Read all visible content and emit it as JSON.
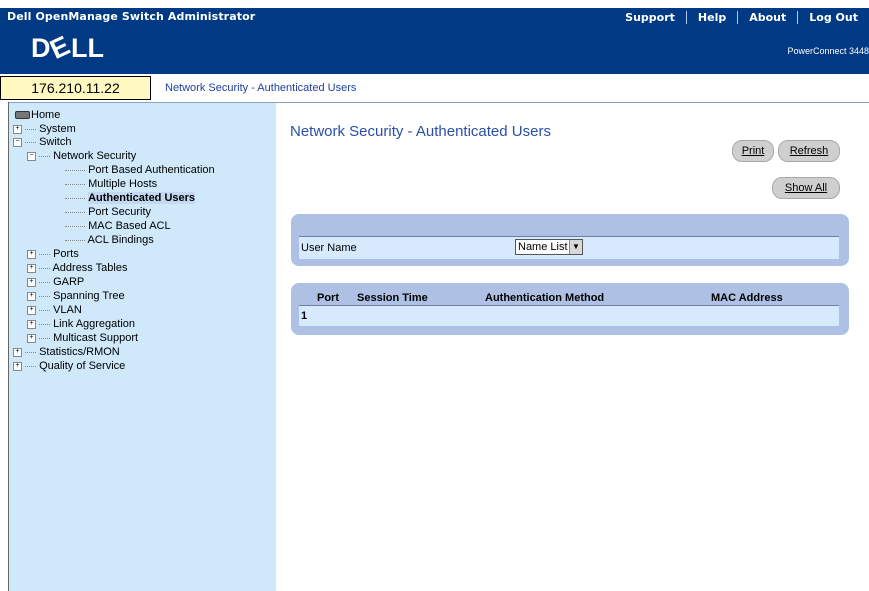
{
  "window": {
    "app_title": "Dell OpenManage Switch Administrator",
    "top_links": [
      "Support",
      "Help",
      "About",
      "Log Out"
    ],
    "logo": "DELL",
    "product": "PowerConnect 3448"
  },
  "address": {
    "ip": "176.210.11.22",
    "breadcrumb": "Network Security - Authenticated Users"
  },
  "sidebar": {
    "items": [
      {
        "label": "Home"
      },
      {
        "label": "System"
      },
      {
        "label": "Switch"
      },
      {
        "label": "Network Security"
      },
      {
        "label": "Port Based Authentication"
      },
      {
        "label": "Multiple Hosts"
      },
      {
        "label": "Authenticated Users"
      },
      {
        "label": "Port Security"
      },
      {
        "label": "MAC Based ACL"
      },
      {
        "label": "ACL Bindings"
      },
      {
        "label": "Ports"
      },
      {
        "label": "Address Tables"
      },
      {
        "label": "GARP"
      },
      {
        "label": "Spanning Tree"
      },
      {
        "label": "VLAN"
      },
      {
        "label": "Link Aggregation"
      },
      {
        "label": "Multicast Support"
      },
      {
        "label": "Statistics/RMON"
      },
      {
        "label": "Quality of Service"
      }
    ]
  },
  "main": {
    "title": "Network Security - Authenticated Users",
    "buttons": {
      "print": "Print",
      "refresh": "Refresh",
      "show_all": "Show All"
    },
    "user_name_label": "User Name",
    "user_name_select": "Name List",
    "table": {
      "headers": [
        "Port",
        "Session Time",
        "Authentication Method",
        "MAC Address"
      ],
      "rows": [
        {
          "index": "1"
        }
      ]
    }
  },
  "colors": {
    "header_bg": "#003a84",
    "sidebar_bg": "#cfe8fa",
    "panel_bg": "#aec0e4",
    "title": "#2a4fa8"
  }
}
